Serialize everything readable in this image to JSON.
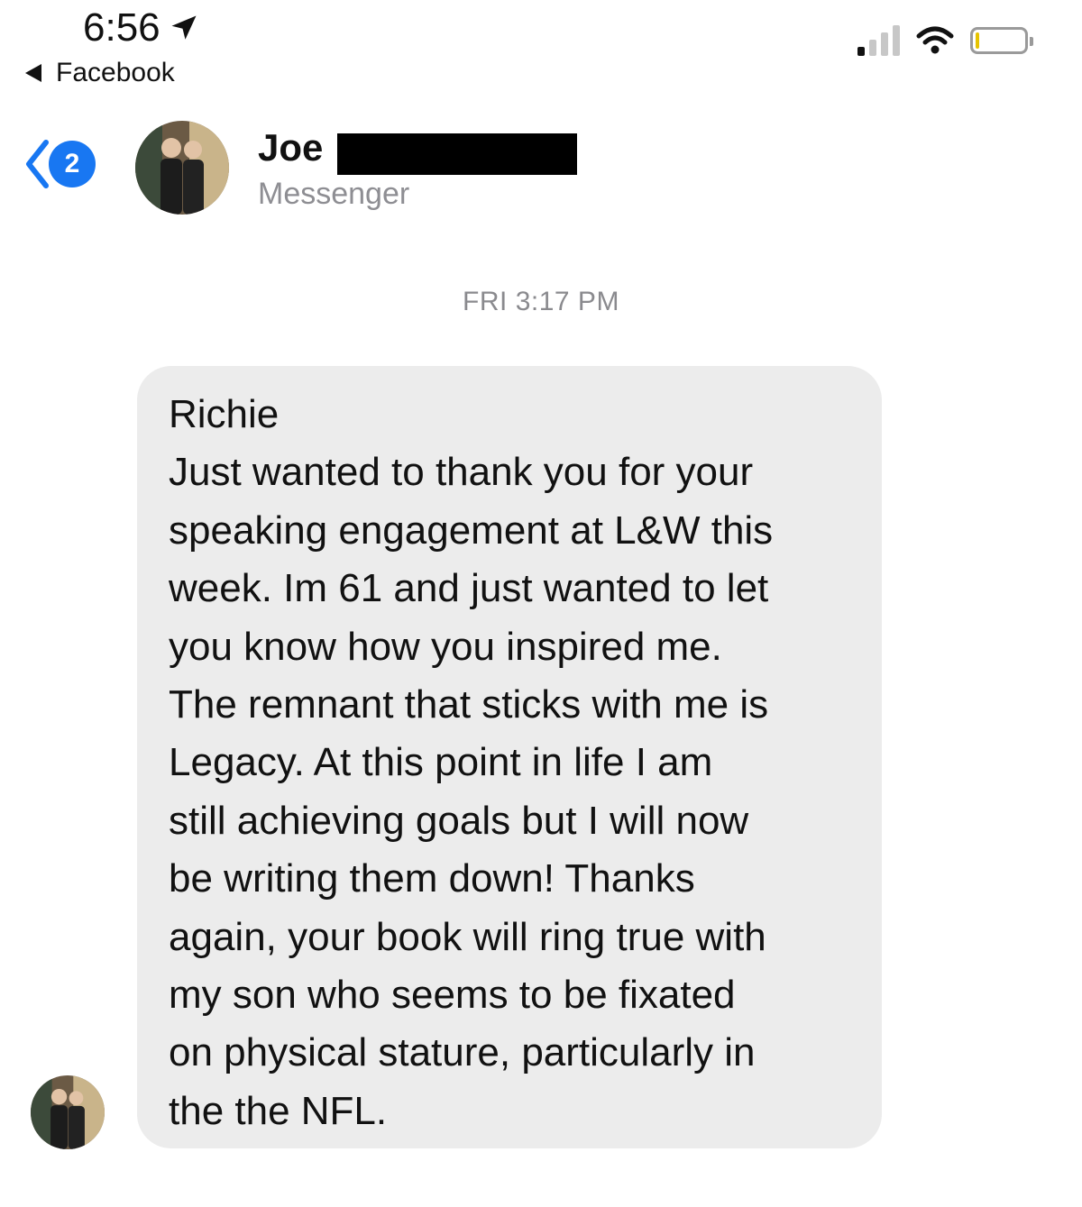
{
  "status_bar": {
    "time": "6:56",
    "back_app_label": "Facebook",
    "signal_bars_active": 1,
    "signal_bars_total": 4,
    "battery_level_percent": 5
  },
  "header": {
    "unread_badge": "2",
    "contact_name": "Joe",
    "contact_subtitle": "Messenger"
  },
  "conversation": {
    "timestamp": "FRI 3:17 PM",
    "message_lines": [
      "Richie",
      "Just wanted to thank you for your",
      "speaking engagement at L&W this",
      "week. Im 61 and just wanted to let",
      "you know how you inspired me.",
      "The remnant that sticks with me is",
      "Legacy. At this point in life I am",
      "still achieving goals but I will now",
      "be writing them down! Thanks",
      "again, your book will ring true with",
      "my son who seems to be fixated",
      "on physical stature, particularly in",
      "the the NFL."
    ]
  },
  "colors": {
    "accent": "#1877f2",
    "bubble": "#ececec",
    "secondary_text": "#8e8e93"
  }
}
